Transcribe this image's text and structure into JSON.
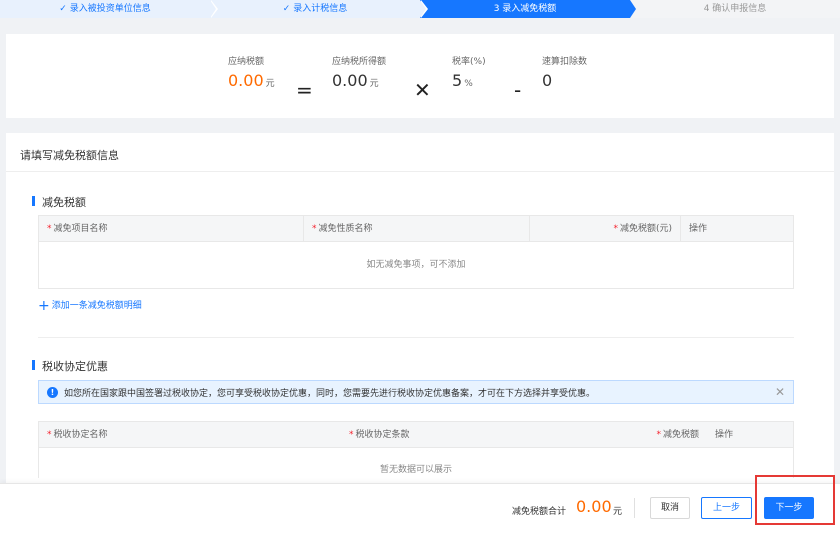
{
  "steps": [
    {
      "label": "✓ 录入被投资单位信息",
      "state": "done"
    },
    {
      "label": "✓ 录入计税信息",
      "state": "done"
    },
    {
      "label": "3  录入减免税额",
      "state": "active"
    },
    {
      "label": "4  确认申报信息",
      "state": "todo"
    }
  ],
  "summary": {
    "tax_payable": {
      "label": "应纳税额",
      "value": "0.00",
      "unit": "元"
    },
    "op_equals": "=",
    "taxable_income": {
      "label": "应纳税所得额",
      "value": "0.00",
      "unit": "元"
    },
    "op_times": "✕",
    "tax_rate": {
      "label": "税率(%)",
      "value": "5",
      "unit": "%"
    },
    "op_minus": "-",
    "quick_deduction": {
      "label": "速算扣除数",
      "value": "0"
    }
  },
  "main": {
    "title": "请填写减免税额信息",
    "reduction": {
      "title": "减免税额",
      "columns": [
        "减免项目名称",
        "减免性质名称",
        "减免税额(元)",
        "操作"
      ],
      "empty_text": "如无减免事项，可不添加",
      "add_link": "添加一条减免税额明细"
    },
    "treaty": {
      "title": "税收协定优惠",
      "alert": "如您所在国家跟中国签署过税收协定，您可享受税收协定优惠，同时，您需要先进行税收协定优惠备案，才可在下方选择并享受优惠。",
      "columns": [
        "税收协定名称",
        "税收协定条款",
        "减免税额",
        "操作"
      ],
      "empty_text": "暂无数据可以展示"
    }
  },
  "footer": {
    "total_label": "减免税额合计",
    "total_value": "0.00",
    "total_unit": "元",
    "cancel": "取消",
    "prev": "上一步",
    "next": "下一步"
  },
  "colors": {
    "primary": "#1677ff",
    "accent": "#ff6a00",
    "highlight": "#e53935"
  }
}
